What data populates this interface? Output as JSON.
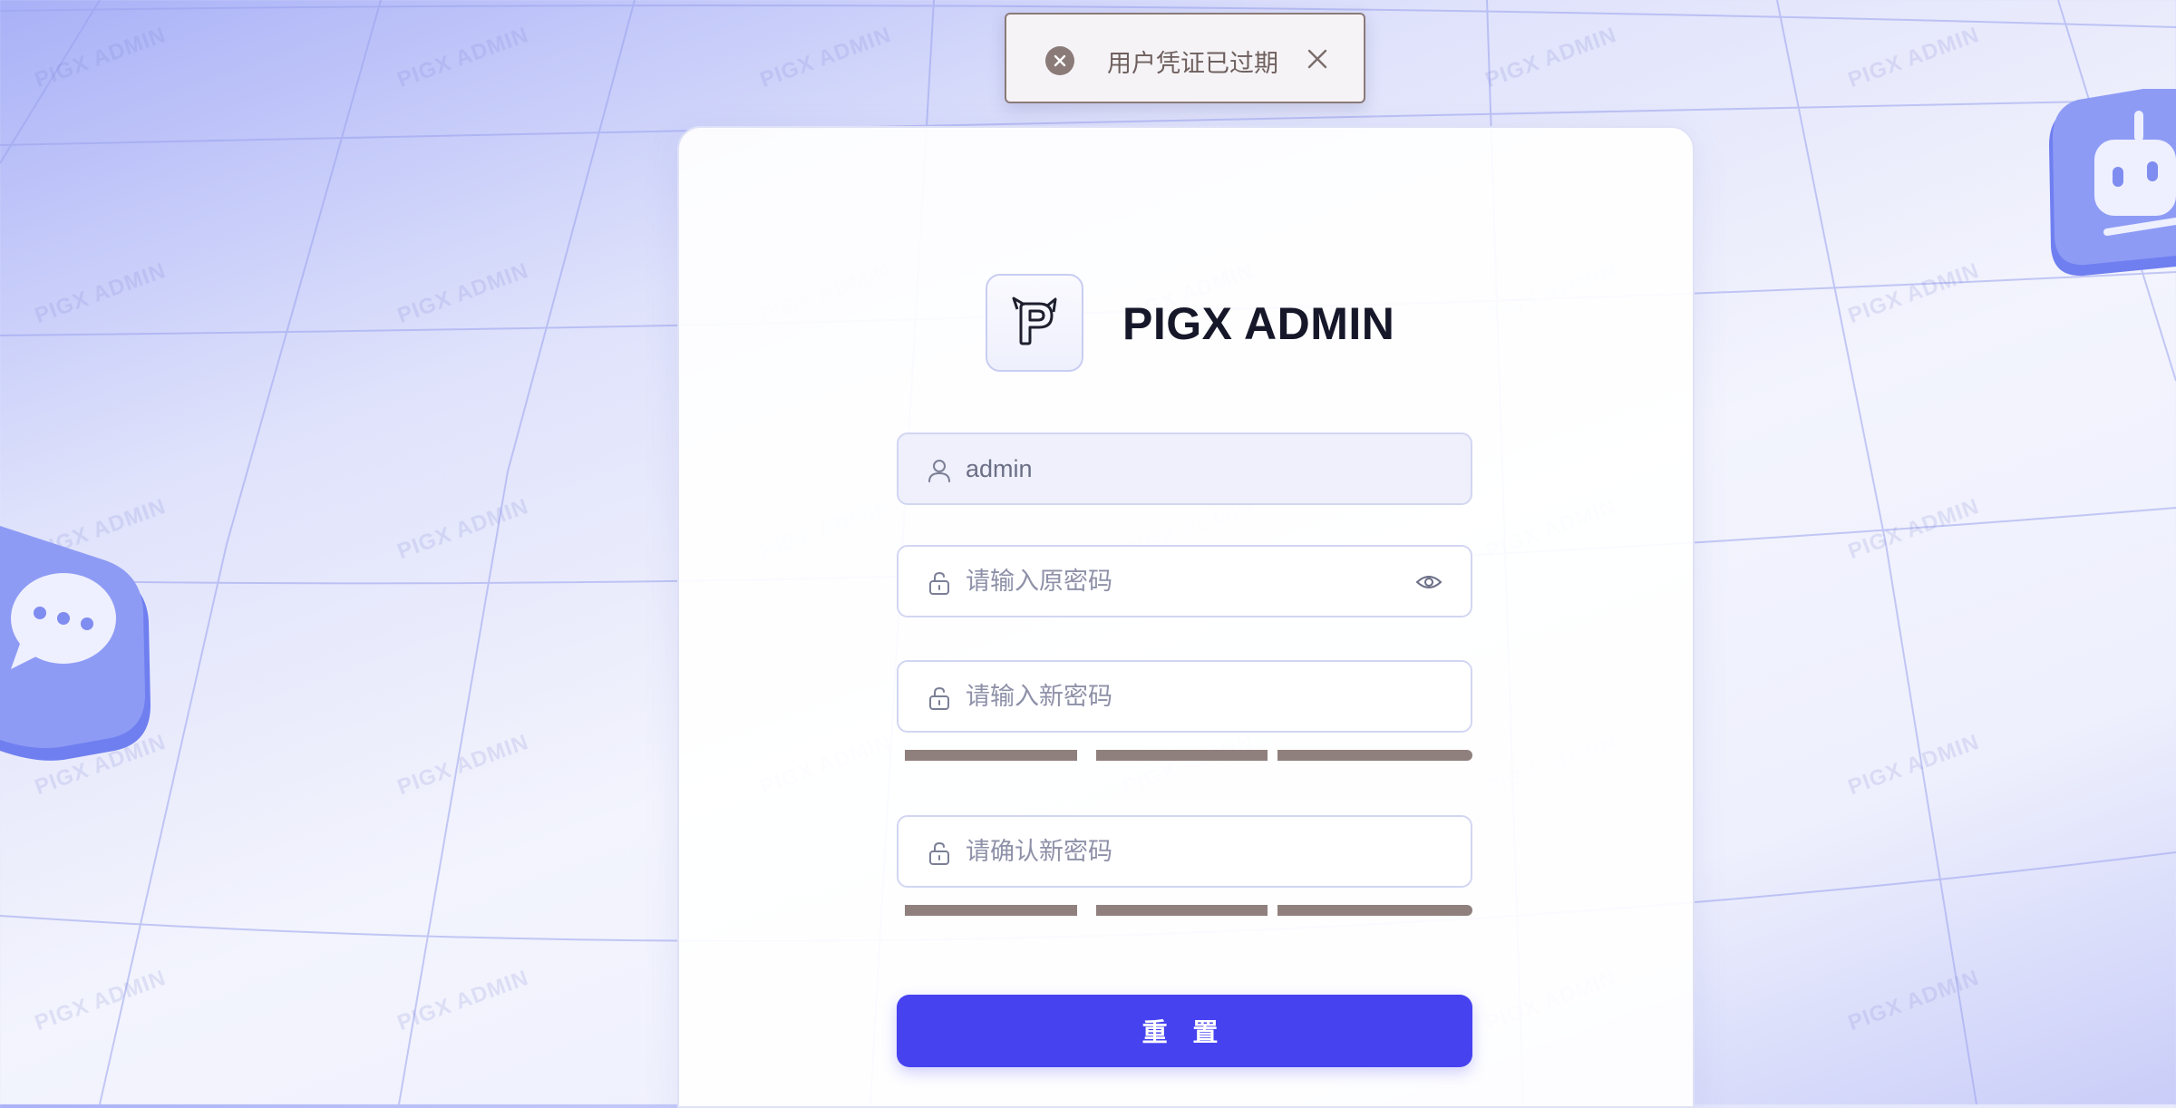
{
  "watermark": "PIGX ADMIN",
  "toast": {
    "message": "用户凭证已过期",
    "icon": "error-circle-icon",
    "close_icon": "close-icon"
  },
  "brand": {
    "name": "PIGX ADMIN",
    "logo_icon": "pig-logo-icon"
  },
  "form": {
    "username": {
      "value": "admin",
      "icon": "user-icon"
    },
    "old_password": {
      "placeholder": "请输入原密码",
      "icon": "lock-icon",
      "toggle_icon": "eye-icon"
    },
    "new_password": {
      "placeholder": "请输入新密码",
      "icon": "lock-icon"
    },
    "confirm_password": {
      "placeholder": "请确认新密码",
      "icon": "lock-icon"
    },
    "submit_label": "重 置"
  },
  "colors": {
    "accent": "#4642f0",
    "toast_border": "#8a7a78",
    "strength_bar": "#8f807e"
  }
}
